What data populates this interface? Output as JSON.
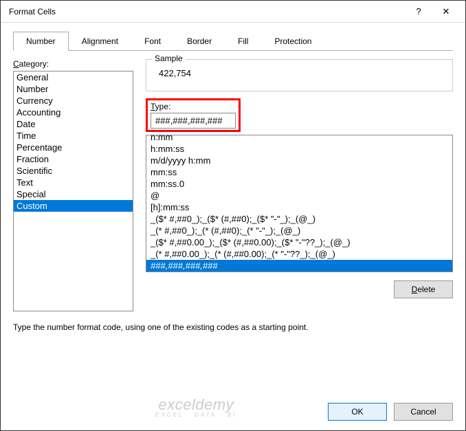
{
  "titlebar": {
    "title": "Format Cells",
    "help": "?",
    "close": "✕"
  },
  "tabs": [
    "Number",
    "Alignment",
    "Font",
    "Border",
    "Fill",
    "Protection"
  ],
  "active_tab": 0,
  "category_label": "Category:",
  "categories": [
    "General",
    "Number",
    "Currency",
    "Accounting",
    "Date",
    "Time",
    "Percentage",
    "Fraction",
    "Scientific",
    "Text",
    "Special",
    "Custom"
  ],
  "selected_category": 11,
  "sample": {
    "legend": "Sample",
    "value": "422,754"
  },
  "type_label": "Type:",
  "type_value": "###,###,###,###",
  "format_list": [
    "h:mm",
    "h:mm:ss",
    "m/d/yyyy h:mm",
    "mm:ss",
    "mm:ss.0",
    "@",
    "[h]:mm:ss",
    "_($* #,##0_);_($* (#,##0);_($* \"-\"_);_(@_)",
    "_(* #,##0_);_(* (#,##0);_(* \"-\"_);_(@_)",
    "_($* #,##0.00_);_($* (#,##0.00);_($* \"-\"??_);_(@_)",
    "_(* #,##0.00_);_(* (#,##0.00);_(* \"-\"??_);_(@_)",
    "###,###,###,###"
  ],
  "selected_format": 11,
  "delete_btn": "Delete",
  "hint": "Type the number format code, using one of the existing codes as a starting point.",
  "ok_btn": "OK",
  "cancel_btn": "Cancel",
  "watermark": {
    "line1": "exceldemy",
    "line2": "EXCEL · DATA · BI"
  }
}
